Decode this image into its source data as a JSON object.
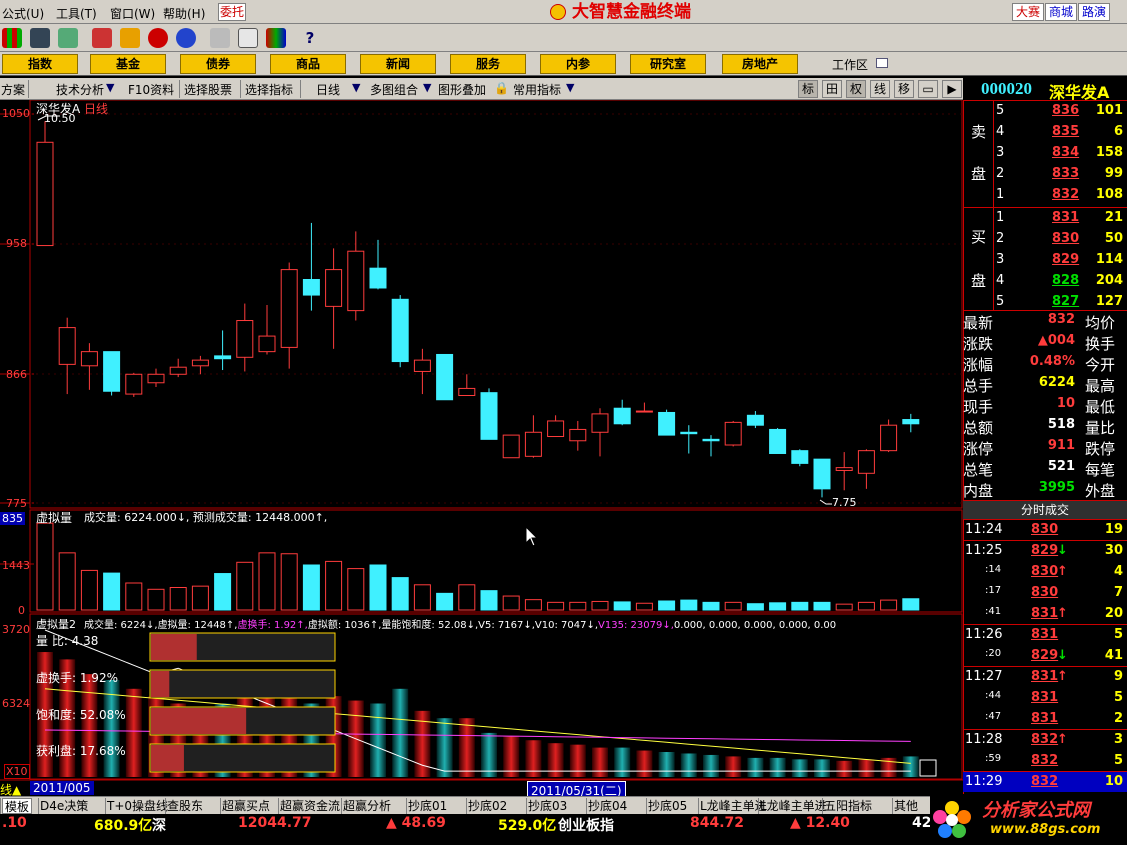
{
  "menu": {
    "items": [
      "公式(U)",
      "工具(T)",
      "窗口(W)",
      "帮助(H)"
    ],
    "weituo": "委托"
  },
  "app_title": "大智慧金融终端",
  "right_tabs": [
    "大赛",
    "商城",
    "路演"
  ],
  "categories": [
    "指数",
    "基金",
    "债券",
    "商品",
    "新闻",
    "服务",
    "内参",
    "研究室",
    "房地产"
  ],
  "workzone": "工作区",
  "subbar": {
    "items": [
      "方案",
      "技术分析",
      "F10资料",
      "选择股票",
      "选择指标",
      "日线",
      "多图组合",
      "图形叠加",
      "常用指标"
    ]
  },
  "tools": [
    "标",
    "田",
    "权",
    "线",
    "移"
  ],
  "stock": {
    "code": "000020",
    "name": "深华发A"
  },
  "chart": {
    "title": "深华发A",
    "period": "日线",
    "high_label": "10.50",
    "low_label": "7.75",
    "price_ticks": [
      "1050",
      "958",
      "866",
      "775"
    ],
    "vol_title": "虚拟量",
    "vol_text": "成交量: 6224.000↓, 预测成交量: 12448.000↑,",
    "vol_tick_top": "835",
    "vol_tick_mid": "1443",
    "vol_tick_bot": "0",
    "ind_title": "虚拟量2",
    "ind_items": [
      {
        "label": "成交量: 6224↓,",
        "color": "#ffffff"
      },
      {
        "label": "虚拟量: 12448↑,",
        "color": "#ffffff"
      },
      {
        "label": "虚换手: 1.92↑,",
        "color": "#ff40ff"
      },
      {
        "label": "虚拟额: 1036↑,",
        "color": "#ffffff"
      },
      {
        "label": "量能饱和度: 52.08↓,",
        "color": "#ffffff"
      },
      {
        "label": "V5: 7167↓,",
        "color": "#ffffff"
      },
      {
        "label": "V10: 7047↓,",
        "color": "#ffffff"
      },
      {
        "label": "V135: 23079↓,",
        "color": "#ff40ff"
      },
      {
        "label": "0.000, 0.000, 0.000, 0.000, 0.00",
        "color": "#ffffff"
      }
    ],
    "ind_ticks": [
      "3720",
      "6324",
      "X10"
    ],
    "gauges": [
      {
        "label": "量 比: 4.38",
        "fill": 0.25
      },
      {
        "label": "虚换手: 1.92%",
        "fill": 0.1
      },
      {
        "label": "饱和度: 52.08%",
        "fill": 0.52
      },
      {
        "label": "获利盘: 17.68%",
        "fill": 0.18
      }
    ],
    "date_left": "2011/005",
    "date_cursor": "2011/05/31(二)"
  },
  "orderbook": {
    "sell_label": [
      "卖",
      "盘"
    ],
    "buy_label": [
      "买",
      "盘"
    ],
    "asks": [
      {
        "n": "5",
        "p": "836",
        "v": "101"
      },
      {
        "n": "4",
        "p": "835",
        "v": "6"
      },
      {
        "n": "3",
        "p": "834",
        "v": "158"
      },
      {
        "n": "2",
        "p": "833",
        "v": "99"
      },
      {
        "n": "1",
        "p": "832",
        "v": "108"
      }
    ],
    "bids": [
      {
        "n": "1",
        "p": "831",
        "v": "21"
      },
      {
        "n": "2",
        "p": "830",
        "v": "50"
      },
      {
        "n": "3",
        "p": "829",
        "v": "114"
      },
      {
        "n": "4",
        "p": "828",
        "v": "204"
      },
      {
        "n": "5",
        "p": "827",
        "v": "127"
      }
    ]
  },
  "quote": [
    {
      "l": "最新",
      "v": "832",
      "r": "均价",
      "vc": "#ff3c3c"
    },
    {
      "l": "涨跌",
      "v": "▲004",
      "r": "换手",
      "vc": "#ff3c3c"
    },
    {
      "l": "涨幅",
      "v": "0.48%",
      "r": "今开",
      "vc": "#ff3c3c"
    },
    {
      "l": "总手",
      "v": "6224",
      "r": "最高",
      "vc": "#ffff00"
    },
    {
      "l": "现手",
      "v": "10",
      "r": "最低",
      "vc": "#ff3c3c"
    },
    {
      "l": "总额",
      "v": "518",
      "r": "量比",
      "vc": "#ffffff"
    },
    {
      "l": "涨停",
      "v": "911",
      "r": "跌停",
      "vc": "#ff3c3c"
    },
    {
      "l": "总笔",
      "v": "521",
      "r": "每笔",
      "vc": "#ffffff"
    },
    {
      "l": "内盘",
      "v": "3995",
      "r": "外盘",
      "vc": "#00e000"
    }
  ],
  "ticks_title": "分时成交",
  "ticks": [
    {
      "t": "11:24",
      "p": "830",
      "a": "",
      "v": "19",
      "pc": "#ff3c3c",
      "ac": ""
    },
    {
      "t": "11:25",
      "p": "829",
      "a": "↓",
      "v": "30",
      "pc": "#ff3c3c",
      "ac": "#00e000"
    },
    {
      "t": ":14",
      "p": "830",
      "a": "↑",
      "v": "4",
      "pc": "#ff3c3c",
      "ac": "#ff3c3c"
    },
    {
      "t": ":17",
      "p": "830",
      "a": "",
      "v": "7",
      "pc": "#ff3c3c",
      "ac": ""
    },
    {
      "t": ":41",
      "p": "831",
      "a": "↑",
      "v": "20",
      "pc": "#ff3c3c",
      "ac": "#ff3c3c"
    },
    {
      "t": "11:26",
      "p": "831",
      "a": "",
      "v": "5",
      "pc": "#ff3c3c",
      "ac": ""
    },
    {
      "t": ":20",
      "p": "829",
      "a": "↓",
      "v": "41",
      "pc": "#ff3c3c",
      "ac": "#00e000"
    },
    {
      "t": "11:27",
      "p": "831",
      "a": "↑",
      "v": "9",
      "pc": "#ff3c3c",
      "ac": "#ff3c3c"
    },
    {
      "t": ":44",
      "p": "831",
      "a": "",
      "v": "5",
      "pc": "#ff3c3c",
      "ac": ""
    },
    {
      "t": ":47",
      "p": "831",
      "a": "",
      "v": "2",
      "pc": "#ff3c3c",
      "ac": ""
    },
    {
      "t": "11:28",
      "p": "832",
      "a": "↑",
      "v": "3",
      "pc": "#ff3c3c",
      "ac": "#ff3c3c"
    },
    {
      "t": ":59",
      "p": "832",
      "a": "",
      "v": "5",
      "pc": "#ff3c3c",
      "ac": ""
    },
    {
      "t": "11:29",
      "p": "832",
      "a": "",
      "v": "10",
      "pc": "#ff3c3c",
      "ac": ""
    }
  ],
  "bottom_tabs": [
    "模板",
    "D4e决策",
    "T+0操盘线",
    "查股东",
    "超赢买点",
    "超赢资金流",
    "超赢分析",
    "抄底01",
    "抄底02",
    "抄底03",
    "抄底04",
    "抄底05",
    "L龙峰主单进",
    "L龙峰主单进",
    "五阳指标",
    "其他"
  ],
  "status": {
    "items": [
      {
        "t": ".10",
        "c": "#ff3c3c"
      },
      {
        "t": "680.9亿",
        "c": "#ffff00"
      },
      {
        "t": "深",
        "c": "#ffffff"
      },
      {
        "t": "12044.77",
        "c": "#ff3c3c"
      },
      {
        "t": "▲ 48.69",
        "c": "#ff3c3c"
      },
      {
        "t": "529.0亿",
        "c": "#ffff00"
      },
      {
        "t": "创业板指",
        "c": "#ffffff"
      },
      {
        "t": "844.72",
        "c": "#ff3c3c"
      },
      {
        "t": "▲ 12.40",
        "c": "#ff3c3c"
      },
      {
        "t": "42",
        "c": "#ffffff"
      }
    ]
  },
  "logo": {
    "name": "分析家公式网",
    "url": "www.88gs.com"
  },
  "candles": [
    {
      "o": 957,
      "c": 1030,
      "h": 1045,
      "l": 957
    },
    {
      "o": 873,
      "c": 899,
      "h": 906,
      "l": 852
    },
    {
      "o": 872,
      "c": 882,
      "h": 888,
      "l": 855
    },
    {
      "o": 882,
      "c": 854,
      "h": 882,
      "l": 851
    },
    {
      "o": 852,
      "c": 866,
      "h": 867,
      "l": 850
    },
    {
      "o": 860,
      "c": 866,
      "h": 870,
      "l": 857
    },
    {
      "o": 866,
      "c": 871,
      "h": 877,
      "l": 864
    },
    {
      "o": 872,
      "c": 876,
      "h": 879,
      "l": 866
    },
    {
      "o": 879,
      "c": 877,
      "h": 897,
      "l": 869
    },
    {
      "o": 878,
      "c": 904,
      "h": 916,
      "l": 868
    },
    {
      "o": 882,
      "c": 893,
      "h": 915,
      "l": 880
    },
    {
      "o": 885,
      "c": 940,
      "h": 945,
      "l": 870
    },
    {
      "o": 933,
      "c": 922,
      "h": 973,
      "l": 911
    },
    {
      "o": 914,
      "c": 940,
      "h": 955,
      "l": 884
    },
    {
      "o": 911,
      "c": 953,
      "h": 967,
      "l": 904
    },
    {
      "o": 941,
      "c": 927,
      "h": 961,
      "l": 926
    },
    {
      "o": 919,
      "c": 875,
      "h": 922,
      "l": 871
    },
    {
      "o": 868,
      "c": 876,
      "h": 884,
      "l": 852
    },
    {
      "o": 880,
      "c": 848,
      "h": 880,
      "l": 848
    },
    {
      "o": 851,
      "c": 856,
      "h": 866,
      "l": 851
    },
    {
      "o": 853,
      "c": 820,
      "h": 856,
      "l": 820
    },
    {
      "o": 807,
      "c": 823,
      "h": 823,
      "l": 807
    },
    {
      "o": 808,
      "c": 825,
      "h": 837,
      "l": 807
    },
    {
      "o": 822,
      "c": 833,
      "h": 837,
      "l": 823
    },
    {
      "o": 819,
      "c": 827,
      "h": 833,
      "l": 812
    },
    {
      "o": 825,
      "c": 838,
      "h": 842,
      "l": 808
    },
    {
      "o": 842,
      "c": 831,
      "h": 848,
      "l": 830
    },
    {
      "o": 840,
      "c": 840,
      "h": 846,
      "l": 839
    },
    {
      "o": 839,
      "c": 823,
      "h": 841,
      "l": 823
    },
    {
      "o": 825,
      "c": 824,
      "h": 830,
      "l": 810
    },
    {
      "o": 820,
      "c": 819,
      "h": 823,
      "l": 808
    },
    {
      "o": 816,
      "c": 832,
      "h": 833,
      "l": 815
    },
    {
      "o": 837,
      "c": 830,
      "h": 840,
      "l": 828
    },
    {
      "o": 827,
      "c": 810,
      "h": 828,
      "l": 810
    },
    {
      "o": 812,
      "c": 803,
      "h": 813,
      "l": 801
    },
    {
      "o": 806,
      "c": 785,
      "h": 806,
      "l": 779
    },
    {
      "o": 798,
      "c": 800,
      "h": 811,
      "l": 784
    },
    {
      "o": 796,
      "c": 812,
      "h": 813,
      "l": 785
    },
    {
      "o": 812,
      "c": 830,
      "h": 834,
      "l": 811
    },
    {
      "o": 834,
      "c": 831,
      "h": 838,
      "l": 825
    }
  ],
  "volumes": [
    1930,
    1270,
    880,
    820,
    600,
    460,
    500,
    530,
    810,
    1060,
    1270,
    1250,
    1000,
    1080,
    920,
    1000,
    720,
    560,
    370,
    560,
    430,
    310,
    230,
    170,
    170,
    190,
    180,
    150,
    200,
    220,
    170,
    170,
    140,
    160,
    170,
    170,
    130,
    170,
    220,
    250
  ],
  "ind_bars": [
    0.85,
    0.8,
    0.7,
    0.66,
    0.6,
    0.55,
    0.5,
    0.45,
    0.5,
    0.55,
    0.62,
    0.6,
    0.5,
    0.55,
    0.52,
    0.5,
    0.6,
    0.45,
    0.4,
    0.4,
    0.3,
    0.28,
    0.25,
    0.23,
    0.22,
    0.2,
    0.2,
    0.18,
    0.17,
    0.16,
    0.15,
    0.14,
    0.13,
    0.13,
    0.12,
    0.12,
    0.11,
    0.12,
    0.13,
    0.14
  ]
}
